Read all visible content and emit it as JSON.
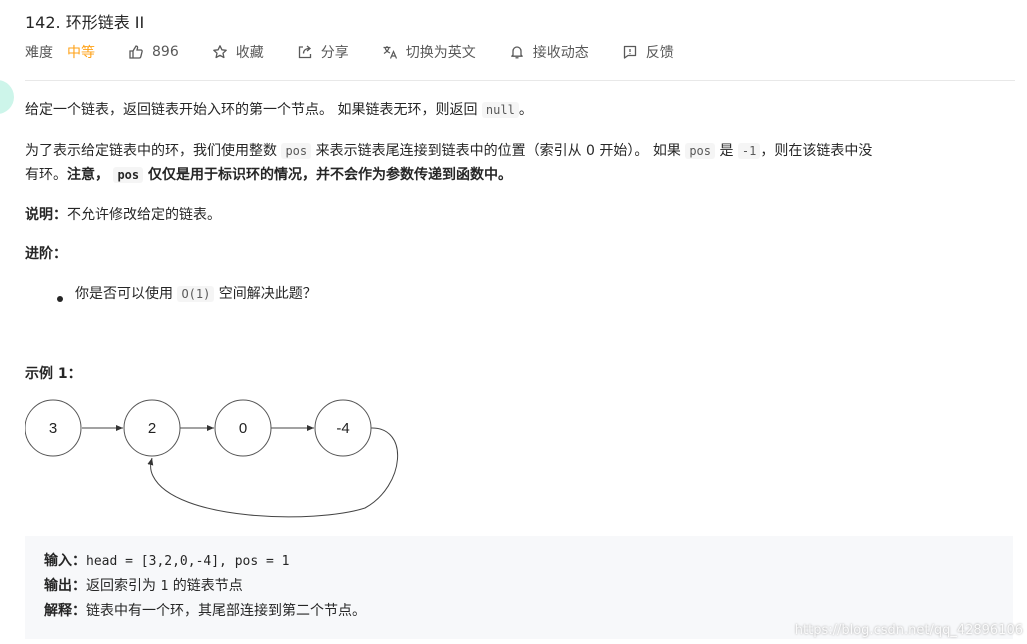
{
  "problem": {
    "title": "142. 环形链表 II",
    "difficulty_label": "难度",
    "difficulty": "中等",
    "likes": "896",
    "actions": {
      "favorite": "收藏",
      "share": "分享",
      "translate": "切换为英文",
      "subscribe": "接收动态",
      "feedback": "反馈"
    }
  },
  "description": {
    "p1_a": "给定一个链表，返回链表开始入环的第一个节点。 如果链表无环，则返回 ",
    "p1_code": "null",
    "p1_b": "。",
    "p2_a": "为了表示给定链表中的环，我们使用整数 ",
    "p2_code1": "pos",
    "p2_b": " 来表示链表尾连接到链表中的位置（索引从 0 开始）。 如果 ",
    "p2_code2": "pos",
    "p2_c": " 是 ",
    "p2_code3": "-1",
    "p2_d": "，则在该链表中没",
    "p3_a": "有环。",
    "p3_bold1": "注意，",
    "p3_code": "pos",
    "p3_bold2": " 仅仅是用于标识环的情况，并不会作为参数传递到函数中。",
    "note_label": "说明：",
    "note_text": "不允许修改给定的链表。",
    "advanced_label": "进阶：",
    "advanced_a": "你是否可以使用 ",
    "advanced_code": "O(1)",
    "advanced_b": " 空间解决此题？",
    "example_title": "示例 1："
  },
  "diagram": {
    "nodes": [
      "3",
      "2",
      "0",
      "-4"
    ]
  },
  "example": {
    "input_label": "输入：",
    "input_value": "head = [3,2,0,-4], pos = 1",
    "output_label": "输出：",
    "output_a": "返回索引为 ",
    "output_code": "1",
    "output_b": " 的链表节点",
    "explain_label": "解释：",
    "explain_text": "链表中有一个环，其尾部连接到第二个节点。"
  },
  "watermark": "https://blog.csdn.net/qq_42896106"
}
